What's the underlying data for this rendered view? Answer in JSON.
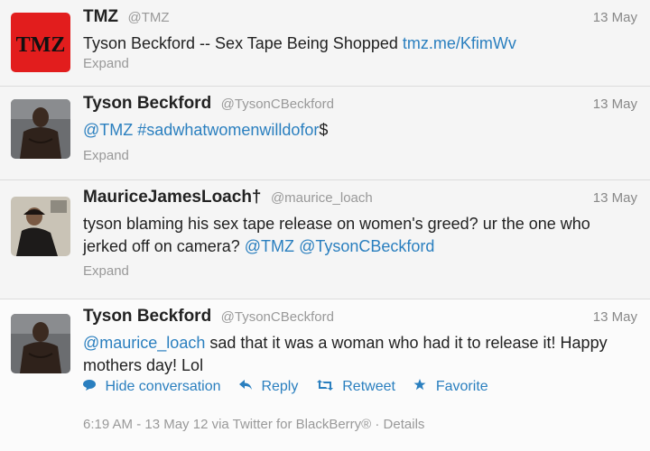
{
  "tweets": [
    {
      "fullname": "TMZ",
      "handle": "@TMZ",
      "date": "13 May",
      "text": "Tyson Beckford -- Sex Tape Being Shopped ",
      "link": "tmz.me/KfimWv",
      "expand": "Expand",
      "avatar_label": "TMZ"
    },
    {
      "fullname": "Tyson Beckford",
      "handle": "@TysonCBeckford",
      "date": "13 May",
      "mention": "@TMZ",
      "hashtag": "#sadwhatwomenwilldofor",
      "suffix": "$",
      "expand": "Expand"
    },
    {
      "fullname": "MauriceJamesLoach†",
      "handle": "@maurice_loach",
      "date": "13 May",
      "text": "tyson blaming his sex tape release on women's greed? ur the one who jerked off on camera? ",
      "mention1": "@TMZ",
      "mention2": "@TysonCBeckford",
      "expand": "Expand"
    },
    {
      "fullname": "Tyson Beckford",
      "handle": "@TysonCBeckford",
      "date": "13 May",
      "mention": "@maurice_loach",
      "text": " sad that it was a woman who had it to release it! Happy mothers day! Lol",
      "actions": {
        "hide": "Hide conversation",
        "reply": "Reply",
        "retweet": "Retweet",
        "favorite": "Favorite"
      },
      "meta": "6:19 AM - 13 May 12 via Twitter for BlackBerry® · Details"
    }
  ],
  "colors": {
    "link": "#2a7fbf",
    "tmz_red": "#e21d1d"
  },
  "icons": [
    "speech-bubble-icon",
    "reply-arrow-icon",
    "retweet-icon",
    "star-icon"
  ]
}
